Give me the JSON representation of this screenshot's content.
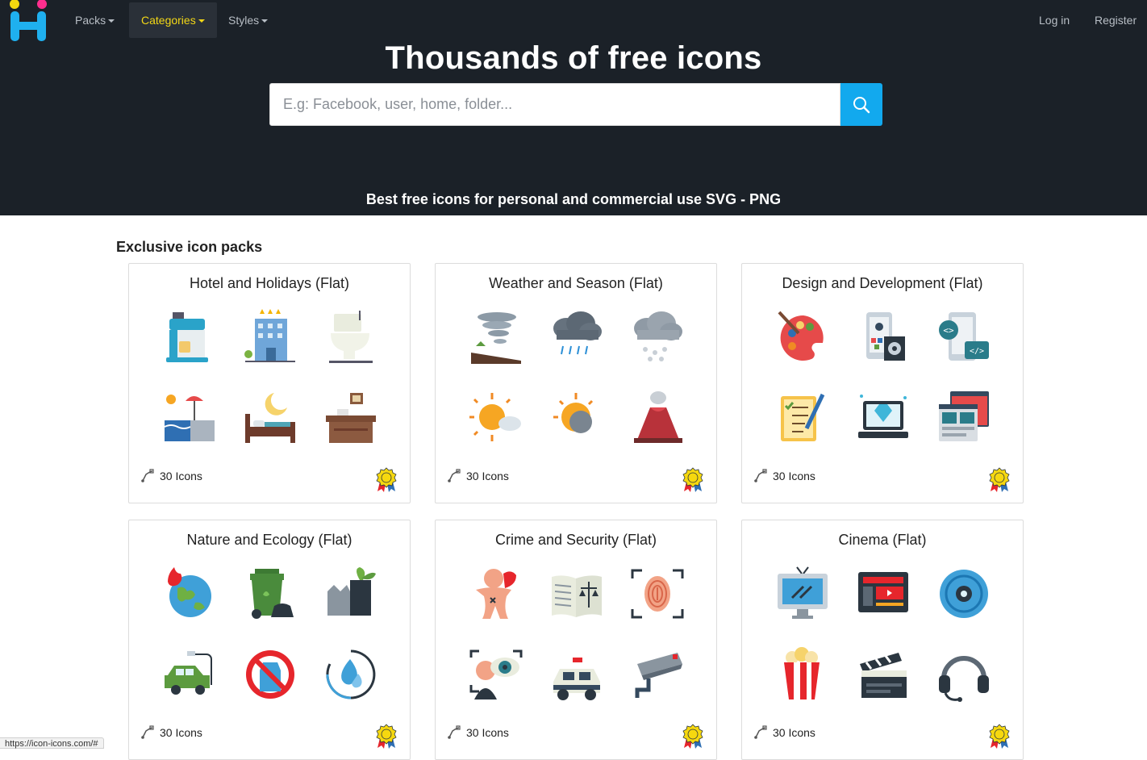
{
  "nav": {
    "logo_alt": "Icon-Icons",
    "items": [
      {
        "label": "Packs",
        "active": false
      },
      {
        "label": "Categories",
        "active": true
      },
      {
        "label": "Styles",
        "active": false
      }
    ],
    "login": "Log in",
    "register": "Register"
  },
  "hero": {
    "title": "Thousands of free icons",
    "search_placeholder": "E.g: Facebook, user, home, folder...",
    "subtitle": "Best free icons for personal and commercial use SVG - PNG"
  },
  "section": {
    "title": "Exclusive icon packs"
  },
  "cards": [
    {
      "title": "Hotel and Holidays (Flat)",
      "count": "30 Icons",
      "icons": [
        "coffee-machine-icon",
        "hotel-building-icon",
        "toilet-icon",
        "beach-pool-icon",
        "bed-night-icon",
        "reception-desk-icon"
      ]
    },
    {
      "title": "Weather and Season (Flat)",
      "count": "30 Icons",
      "icons": [
        "tornado-icon",
        "rain-cloud-icon",
        "snow-cloud-icon",
        "sun-cloud-icon",
        "eclipse-icon",
        "volcano-icon"
      ]
    },
    {
      "title": "Design and Development (Flat)",
      "count": "30 Icons",
      "icons": [
        "color-palette-icon",
        "mobile-settings-icon",
        "mobile-code-icon",
        "checklist-pen-icon",
        "laptop-diamond-icon",
        "web-layout-icon"
      ]
    },
    {
      "title": "Nature and Ecology (Flat)",
      "count": "30 Icons",
      "icons": [
        "burning-earth-icon",
        "trash-bin-icon",
        "factory-plant-icon",
        "electric-car-icon",
        "no-plastic-icon",
        "water-cycle-icon"
      ]
    },
    {
      "title": "Crime and Security (Flat)",
      "count": "30 Icons",
      "icons": [
        "voodoo-doll-icon",
        "law-book-icon",
        "fingerprint-scan-icon",
        "eye-scan-icon",
        "police-car-icon",
        "security-camera-icon"
      ]
    },
    {
      "title": "Cinema (Flat)",
      "count": "30 Icons",
      "icons": [
        "tv-screen-icon",
        "video-editor-icon",
        "film-reel-icon",
        "popcorn-icon",
        "clapperboard-icon",
        "headset-icon"
      ]
    }
  ],
  "status_bar": {
    "url": "https://icon-icons.com/#"
  },
  "colors": {
    "header_bg": "#1b2128",
    "accent": "#12a9ee",
    "active_nav": "#f3d716"
  }
}
